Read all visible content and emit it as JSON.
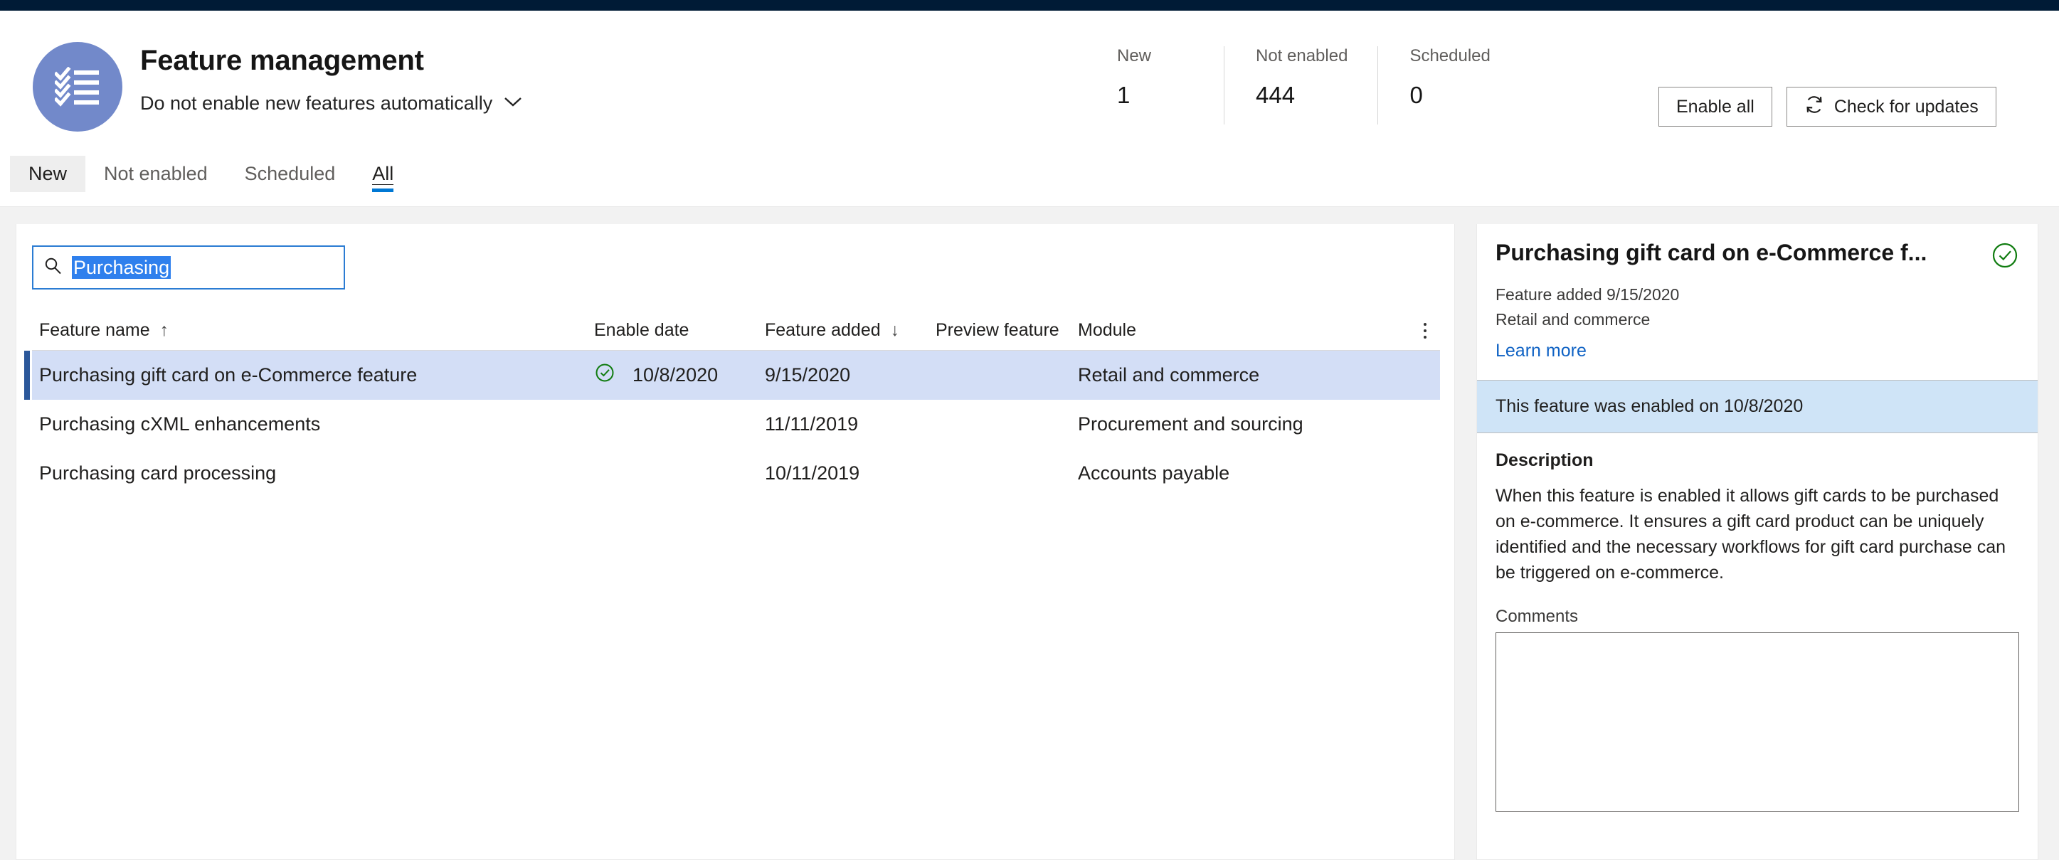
{
  "topbar": {
    "color": "#001b36"
  },
  "header": {
    "icon": "checklist-icon",
    "icon_bg": "#7289ca",
    "title": "Feature management",
    "subtitle": "Do not enable new features automatically",
    "subtitle_chevron": "chevron-down-icon"
  },
  "stats": [
    {
      "label": "New",
      "value": "1"
    },
    {
      "label": "Not enabled",
      "value": "444"
    },
    {
      "label": "Scheduled",
      "value": "0"
    }
  ],
  "header_actions": {
    "enable_all": "Enable all",
    "check_updates": "Check for updates",
    "check_updates_icon": "refresh-icon"
  },
  "tabs": [
    {
      "label": "New",
      "state": "hover"
    },
    {
      "label": "Not enabled",
      "state": "normal"
    },
    {
      "label": "Scheduled",
      "state": "normal"
    },
    {
      "label": "All",
      "state": "active"
    }
  ],
  "search": {
    "icon": "search-icon",
    "value": "Purchasing",
    "placeholder": "Filter",
    "selected": true,
    "focused": true,
    "selection_color": "#2f80ed",
    "focus_border_color": "#2b7cd3"
  },
  "table": {
    "columns": [
      {
        "key": "name",
        "label": "Feature name",
        "sort": "asc"
      },
      {
        "key": "enable",
        "label": "Enable date",
        "sort": "none"
      },
      {
        "key": "added",
        "label": "Feature added",
        "sort": "desc"
      },
      {
        "key": "preview",
        "label": "Preview feature",
        "sort": "none"
      },
      {
        "key": "module",
        "label": "Module",
        "sort": "none"
      }
    ],
    "sort_asc_glyph": "↑",
    "sort_desc_glyph": "↓",
    "overflow_menu": "more-options-icon",
    "rows": [
      {
        "name": "Purchasing gift card on e-Commerce feature",
        "enabled_icon": "enabled-check-icon",
        "enable_date": "10/8/2020",
        "feature_added": "9/15/2020",
        "preview_feature": "",
        "module": "Retail and commerce",
        "selected": true
      },
      {
        "name": "Purchasing cXML enhancements",
        "enabled_icon": "",
        "enable_date": "",
        "feature_added": "11/11/2019",
        "preview_feature": "",
        "module": "Procurement and sourcing",
        "selected": false
      },
      {
        "name": "Purchasing card processing",
        "enabled_icon": "",
        "enable_date": "",
        "feature_added": "10/11/2019",
        "preview_feature": "",
        "module": "Accounts payable",
        "selected": false
      }
    ]
  },
  "detail": {
    "title": "Purchasing gift card on e-Commerce f...",
    "status_icon": "enabled-check-icon",
    "status_color": "#107c10",
    "added_line": "Feature added 9/15/2020",
    "module_line": "Retail and commerce",
    "learn_more": "Learn more",
    "banner": "This feature was enabled on 10/8/2020",
    "banner_bg": "#cfe4f7",
    "description_heading": "Description",
    "description": "When this feature is enabled it allows gift cards to be purchased on e-commerce. It ensures a gift card product can be uniquely identified and the necessary workflows for gift card purchase can be triggered on e-commerce.",
    "comments_label": "Comments",
    "comments_value": "",
    "comments_placeholder": ""
  },
  "colors": {
    "accent": "#0078d4",
    "selected_row": "#d3def6",
    "selected_row_bar": "#2b579a",
    "green": "#107c10",
    "link": "#0f62c4"
  }
}
